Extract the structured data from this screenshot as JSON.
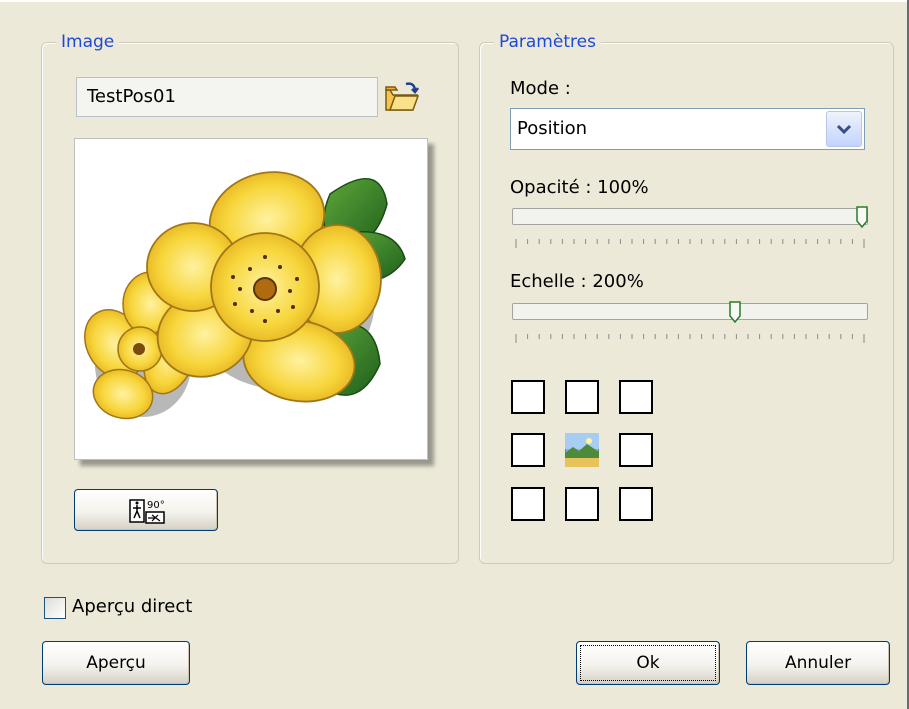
{
  "image_group": {
    "legend": "Image",
    "filename": "TestPos01",
    "rotate_button": {
      "icon": "rotate-90-icon",
      "badge": "90°"
    }
  },
  "params_group": {
    "legend": "Paramètres",
    "mode_label": "Mode :",
    "mode_value": "Position",
    "opacity_label": "Opacité : 100%",
    "opacity_value": 1.0,
    "scale_label": "Echelle : 200%",
    "scale_value": 0.63,
    "position_grid": {
      "rows": 3,
      "cols": 3,
      "selected": "center"
    }
  },
  "live_preview": {
    "label": "Aperçu direct",
    "checked": false
  },
  "buttons": {
    "preview": "Aperçu",
    "ok": "Ok",
    "cancel": "Annuler"
  },
  "colors": {
    "legend": "#1f48d8",
    "background": "#ece9d8",
    "button_border": "#003c74"
  }
}
